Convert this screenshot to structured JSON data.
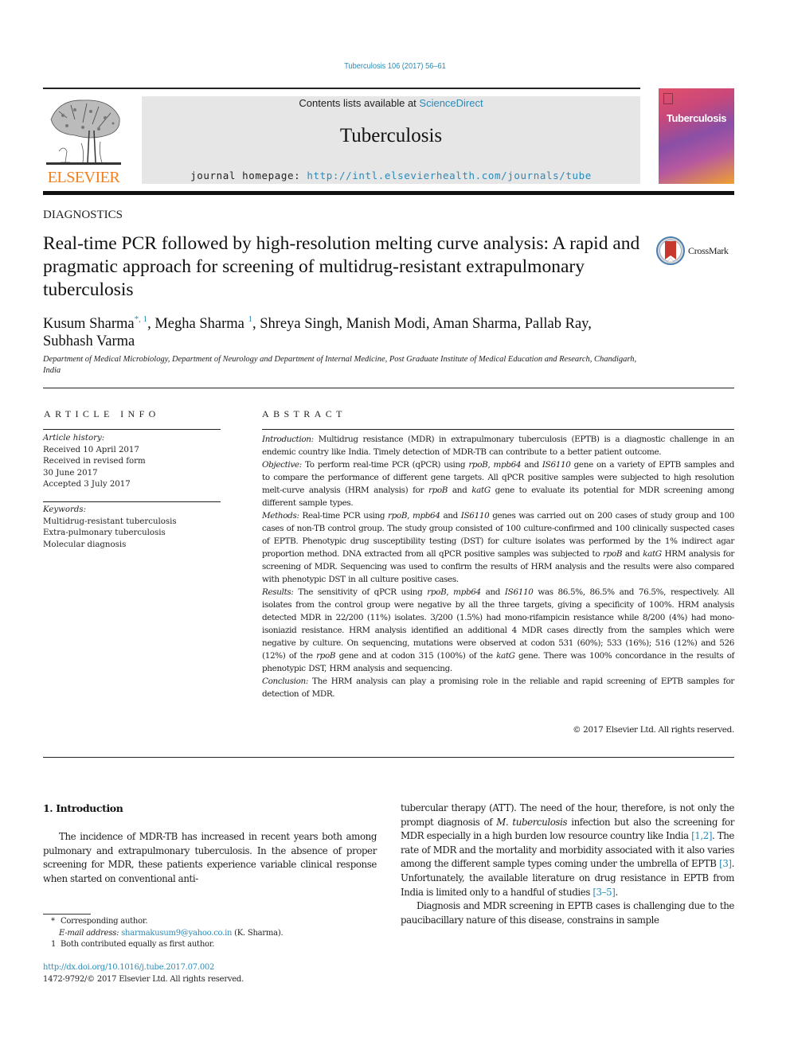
{
  "header": {
    "citation": "Tuberculosis 106 (2017) 56–61",
    "contents_prefix": "Contents lists available at ",
    "contents_link": "ScienceDirect",
    "journal_name": "Tuberculosis",
    "homepage_prefix": "journal homepage: ",
    "homepage_url": "http://intl.elsevierhealth.com/journals/tube",
    "publisher_logo_text": "ELSEVIER",
    "cover_title": "Tuberculosis",
    "accent_color": "#2a8ab8",
    "publisher_color": "#f07f1e"
  },
  "article": {
    "section": "DIAGNOSTICS",
    "title": "Real-time PCR followed by high-resolution melting curve analysis: A rapid and pragmatic approach for screening of multidrug-resistant extrapulmonary tuberculosis",
    "crossmark_label": "CrossMark",
    "authors": [
      {
        "name": "Kusum Sharma",
        "marks": "*, 1"
      },
      {
        "name": "Megha Sharma",
        "marks": "1"
      },
      {
        "name": "Shreya Singh",
        "marks": ""
      },
      {
        "name": "Manish Modi",
        "marks": ""
      },
      {
        "name": "Aman Sharma",
        "marks": ""
      },
      {
        "name": "Pallab Ray",
        "marks": ""
      },
      {
        "name": "Subhash Varma",
        "marks": ""
      }
    ],
    "affiliation": "Department of Medical Microbiology, Department of Neurology and Department of Internal Medicine, Post Graduate Institute of Medical Education and Research, Chandigarh, India"
  },
  "article_info": {
    "heading": "ARTICLE INFO",
    "history_label": "Article history:",
    "history": [
      "Received 10 April 2017",
      "Received in revised form",
      "30 June 2017",
      "Accepted 3 July 2017"
    ],
    "keywords_label": "Keywords:",
    "keywords": [
      "Multidrug-resistant tuberculosis",
      "Extra-pulmonary tuberculosis",
      "Molecular diagnosis"
    ]
  },
  "abstract": {
    "heading": "ABSTRACT",
    "sections": [
      {
        "label": "Introduction:",
        "text": "Multidrug resistance (MDR) in extrapulmonary tuberculosis (EPTB) is a diagnostic challenge in an endemic country like India. Timely detection of MDR-TB can contribute to a better patient outcome."
      },
      {
        "label": "Objective:",
        "text": "To perform real-time PCR (qPCR) using rpoB, mpb64 and IS6110 gene on a variety of EPTB samples and to compare the performance of different gene targets. All qPCR positive samples were subjected to high resolution melt-curve analysis (HRM analysis) for rpoB and katG gene to evaluate its potential for MDR screening among different sample types."
      },
      {
        "label": "Methods:",
        "text": "Real-time PCR using rpoB, mpb64 and IS6110 genes was carried out on 200 cases of study group and 100 cases of non-TB control group. The study group consisted of 100 culture-confirmed and 100 clinically suspected cases of EPTB. Phenotypic drug susceptibility testing (DST) for culture isolates was performed by the 1% indirect agar proportion method. DNA extracted from all qPCR positive samples was subjected to rpoB and katG HRM analysis for screening of MDR. Sequencing was used to confirm the results of HRM analysis and the results were also compared with phenotypic DST in all culture positive cases."
      },
      {
        "label": "Results:",
        "text": "The sensitivity of qPCR using rpoB, mpb64 and IS6110 was 86.5%, 86.5% and 76.5%, respectively. All isolates from the control group were negative by all the three targets, giving a specificity of 100%. HRM analysis detected MDR in 22/200 (11%) isolates. 3/200 (1.5%) had mono-rifampicin resistance while 8/200 (4%) had mono-isoniazid resistance. HRM analysis identified an additional 4 MDR cases directly from the samples which were negative by culture. On sequencing, mutations were observed at codon 531 (60%); 533 (16%); 516 (12%) and 526 (12%) of the rpoB gene and at codon 315 (100%) of the katG gene. There was 100% concordance in the results of phenotypic DST, HRM analysis and sequencing."
      },
      {
        "label": "Conclusion:",
        "text": "The HRM analysis can play a promising role in the reliable and rapid screening of EPTB samples for detection of MDR."
      }
    ],
    "copyright": "© 2017 Elsevier Ltd. All rights reserved."
  },
  "body": {
    "intro_heading": "1.  Introduction",
    "left_para": "The incidence of MDR-TB has increased in recent years both among pulmonary and extrapulmonary tuberculosis. In the absence of proper screening for MDR, these patients experience variable clinical response when started on conventional anti-",
    "right_para1_a": "tubercular therapy (ATT). The need of the hour, therefore, is not only the prompt diagnosis of ",
    "right_para1_species": "M. tuberculosis",
    "right_para1_b": " infection but also the screening for MDR especially in a high burden low resource country like India ",
    "ref_1": "[1,2]",
    "right_para1_c": ". The rate of MDR and the mortality and morbidity associated with it also varies among the different sample types coming under the umbrella of EPTB ",
    "ref_2": "[3]",
    "right_para1_d": ". Unfortunately, the available literature on drug resistance in EPTB from India is limited only to a handful of studies ",
    "ref_3": "[3–5]",
    "right_para1_e": ".",
    "right_para2": "Diagnosis and MDR screening in EPTB cases is challenging due to the paucibacillary nature of this disease, constrains in sample"
  },
  "footnotes": {
    "corresponding_mark": "*",
    "corresponding": "Corresponding author.",
    "email_label": "E-mail address:",
    "email": "sharmakusum9@yahoo.co.in",
    "email_owner": "(K. Sharma).",
    "equal_mark": "1",
    "equal": "Both contributed equally as first author.",
    "doi": "http://dx.doi.org/10.1016/j.tube.2017.07.002",
    "issn": "1472-9792/© 2017 Elsevier Ltd. All rights reserved."
  }
}
